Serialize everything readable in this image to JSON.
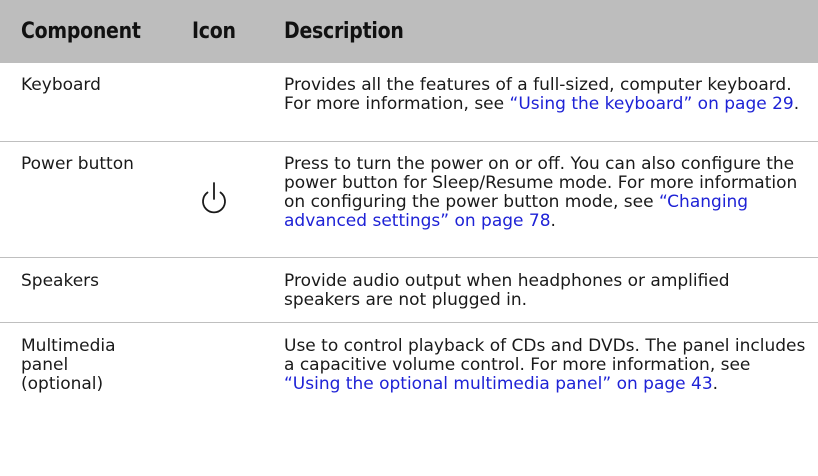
{
  "header": {
    "component": "Component",
    "icon": "Icon",
    "description": "Description"
  },
  "rows": [
    {
      "component": [
        "Keyboard"
      ],
      "icon": null,
      "description_text": "Provides all the features of a full-sized, computer keyboard. For more information, see ",
      "link_text": "“Using the keyboard” on page 29",
      "tail": "."
    },
    {
      "component": [
        "Power button"
      ],
      "icon": "power-icon",
      "description_text": "Press to turn the power on or off. You can also configure the power button for Sleep/Resume mode. For more information on configuring the power button mode, see ",
      "link_text": "“Changing advanced settings” on page 78",
      "tail": "."
    },
    {
      "component": [
        "Speakers"
      ],
      "icon": null,
      "description_text": "Provide audio output when headphones or amplified speakers are not plugged in.",
      "link_text": "",
      "tail": ""
    },
    {
      "component": [
        "Multimedia",
        "panel",
        "(optional)"
      ],
      "icon": null,
      "description_text": "Use to control playback of CDs and DVDs. The panel includes a capacitive volume control. For more information, see ",
      "link_text": "“Using the optional multimedia panel” on page 43",
      "tail": "."
    }
  ],
  "colors": {
    "header_bg": "#bdbdbd",
    "link": "#1e22d6",
    "divider": "#bfbfbf"
  }
}
